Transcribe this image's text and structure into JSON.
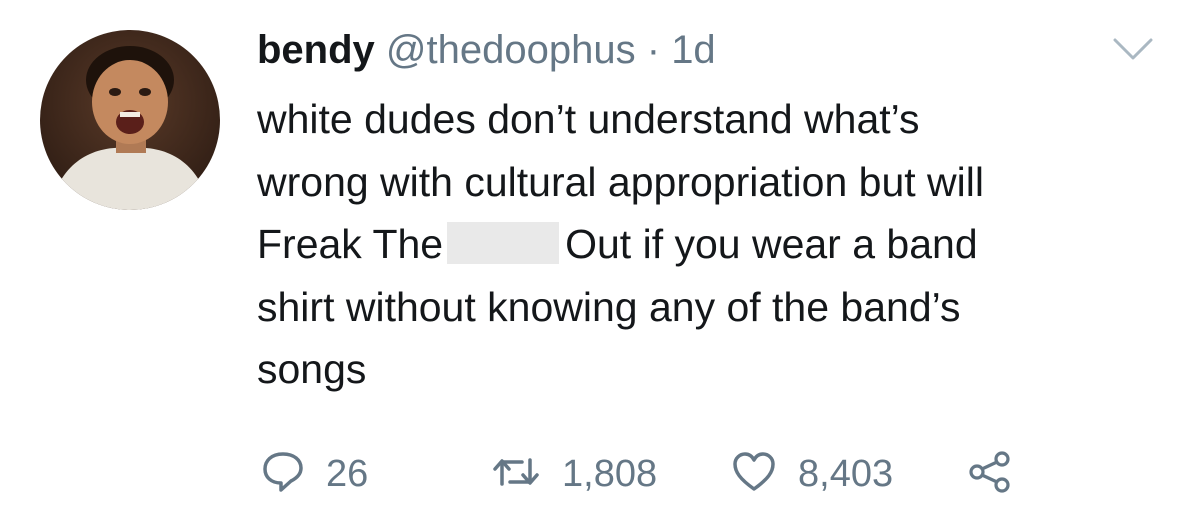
{
  "tweet": {
    "display_name": "bendy",
    "handle": "@thedoophus",
    "separator": "·",
    "time": "1d",
    "text": {
      "line1": "white dudes don’t understand what’s",
      "line2": "wrong with cultural appropriation but will",
      "line3_before": "Freak The",
      "line3_after": "Out if you wear a band",
      "line4": "shirt without knowing any of the band’s",
      "line5": "songs"
    },
    "redacted": true
  },
  "actions": {
    "reply_count": "26",
    "retweet_count": "1,808",
    "like_count": "8,403"
  },
  "icons": {
    "more": "chevron-down-icon",
    "reply": "reply-icon",
    "retweet": "retweet-icon",
    "like": "heart-icon",
    "share": "share-icon"
  },
  "colors": {
    "text": "#14171a",
    "secondary": "#657786",
    "redaction": "#e9e9e9"
  }
}
